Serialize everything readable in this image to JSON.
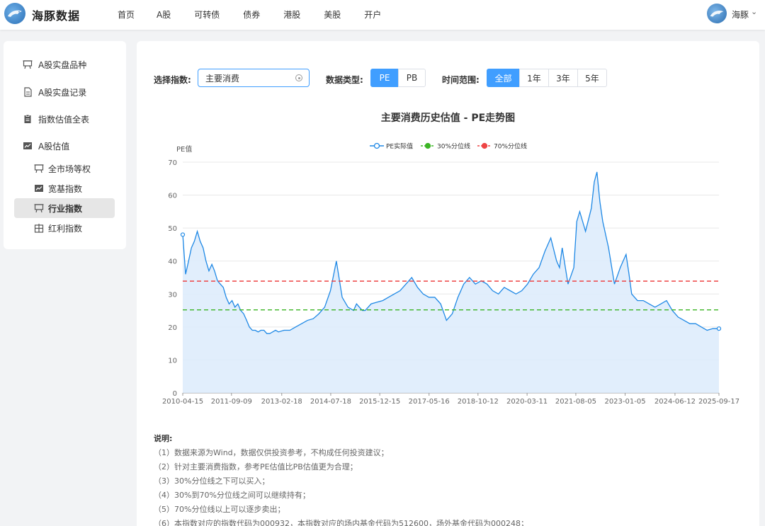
{
  "header": {
    "logo_text": "海豚数据",
    "nav": [
      "首页",
      "A股",
      "可转债",
      "债券",
      "港股",
      "美股",
      "开户"
    ],
    "user_name": "海豚"
  },
  "sidebar": {
    "items": [
      {
        "label": "A股实盘品种",
        "icon": "presentation-icon"
      },
      {
        "label": "A股实盘记录",
        "icon": "document-icon"
      },
      {
        "label": "指数估值全表",
        "icon": "clipboard-icon"
      },
      {
        "label": "A股估值",
        "icon": "chart-icon"
      }
    ],
    "sub_items": [
      {
        "label": "全市场等权",
        "icon": "presentation-icon"
      },
      {
        "label": "宽基指数",
        "icon": "chart-icon"
      },
      {
        "label": "行业指数",
        "icon": "presentation-icon",
        "active": true
      },
      {
        "label": "红利指数",
        "icon": "grid-icon"
      }
    ]
  },
  "controls": {
    "index_label": "选择指数:",
    "index_value": "主要消费",
    "type_label": "数据类型:",
    "type_options": [
      "PE",
      "PB"
    ],
    "type_selected": "PE",
    "range_label": "时间范围:",
    "range_options": [
      "全部",
      "1年",
      "3年",
      "5年"
    ],
    "range_selected": "全部"
  },
  "chart_data": {
    "type": "line",
    "title": "主要消费历史估值 - PE走势图",
    "ylabel": "PE值",
    "ylim": [
      0,
      70
    ],
    "yticks": [
      0,
      10,
      20,
      30,
      40,
      50,
      60,
      70
    ],
    "xtick_labels": [
      "2010-04-15",
      "2011-09-09",
      "2013-02-18",
      "2014-07-18",
      "2015-12-15",
      "2017-05-16",
      "2018-10-12",
      "2020-03-11",
      "2021-08-05",
      "2023-01-05",
      "2024-06-12",
      "2025-09-17"
    ],
    "legend": [
      "PE实际值",
      "30%分位线",
      "70%分位线"
    ],
    "legend_position": "top-center",
    "colors": {
      "pe": "#1e88e5",
      "p30": "#3cb525",
      "p70": "#ee4444",
      "area": "#dcebfb"
    },
    "percentile_30": 25.2,
    "percentile_70": 33.9,
    "series": [
      {
        "name": "PE实际值",
        "x": [
          "2010-04-15",
          "2010-05-15",
          "2010-06-15",
          "2010-07-15",
          "2010-08-15",
          "2010-09-15",
          "2010-10-15",
          "2010-11-15",
          "2010-12-15",
          "2011-01-15",
          "2011-02-15",
          "2011-03-15",
          "2011-04-15",
          "2011-05-15",
          "2011-06-15",
          "2011-07-15",
          "2011-08-15",
          "2011-09-15",
          "2011-10-15",
          "2011-11-15",
          "2011-12-15",
          "2012-01-15",
          "2012-02-15",
          "2012-03-15",
          "2012-04-15",
          "2012-05-15",
          "2012-06-15",
          "2012-07-15",
          "2012-08-15",
          "2012-09-15",
          "2012-10-15",
          "2012-11-15",
          "2012-12-15",
          "2013-01-15",
          "2013-03-15",
          "2013-05-15",
          "2013-07-15",
          "2013-09-15",
          "2013-11-15",
          "2014-01-15",
          "2014-03-15",
          "2014-05-15",
          "2014-07-15",
          "2014-09-15",
          "2014-11-15",
          "2015-01-15",
          "2015-03-15",
          "2015-04-15",
          "2015-05-15",
          "2015-06-15",
          "2015-07-15",
          "2015-08-15",
          "2015-09-15",
          "2015-11-15",
          "2016-01-15",
          "2016-03-15",
          "2016-05-15",
          "2016-07-15",
          "2016-09-15",
          "2016-11-15",
          "2017-01-15",
          "2017-03-15",
          "2017-05-15",
          "2017-07-15",
          "2017-09-15",
          "2017-11-15",
          "2018-01-15",
          "2018-03-15",
          "2018-05-15",
          "2018-07-15",
          "2018-09-15",
          "2018-11-15",
          "2019-01-15",
          "2019-03-15",
          "2019-05-15",
          "2019-07-15",
          "2019-09-15",
          "2019-11-15",
          "2020-01-15",
          "2020-03-15",
          "2020-05-15",
          "2020-07-15",
          "2020-09-15",
          "2020-11-15",
          "2021-01-15",
          "2021-02-15",
          "2021-03-15",
          "2021-05-15",
          "2021-07-15",
          "2021-08-15",
          "2021-09-15",
          "2021-11-15",
          "2022-01-15",
          "2022-02-15",
          "2022-03-15",
          "2022-04-15",
          "2022-05-15",
          "2022-07-15",
          "2022-09-15",
          "2022-11-15",
          "2022-12-15",
          "2023-01-15",
          "2023-02-15",
          "2023-03-15",
          "2023-05-15",
          "2023-07-15",
          "2023-09-15",
          "2023-11-15",
          "2024-01-15",
          "2024-03-15",
          "2024-05-15",
          "2024-07-15",
          "2024-09-15",
          "2024-11-15",
          "2025-01-15",
          "2025-03-15",
          "2025-05-15",
          "2025-07-15",
          "2025-09-17"
        ],
        "values": [
          48,
          36,
          40,
          44,
          46,
          49,
          46,
          44,
          40,
          37,
          39,
          37,
          34,
          33,
          32,
          29,
          27,
          28,
          26,
          27,
          25,
          24,
          22,
          20,
          19,
          19,
          18.5,
          19,
          19,
          18,
          18,
          18.5,
          19,
          18.5,
          19,
          19,
          20,
          21,
          22,
          22.5,
          24,
          26,
          31,
          40,
          29,
          26,
          25,
          27,
          26,
          25,
          25,
          26,
          27,
          27.5,
          28,
          29,
          30,
          31,
          33,
          35,
          32,
          30,
          29,
          29,
          27,
          22,
          24,
          29,
          33,
          35,
          33,
          34,
          33,
          31,
          30,
          32,
          31,
          30,
          31,
          33,
          36,
          38,
          43,
          47,
          40,
          38,
          44,
          33,
          38,
          52,
          55,
          49,
          56,
          64,
          67,
          58,
          52,
          44,
          33,
          38,
          40,
          42,
          36,
          30,
          28,
          28,
          27,
          26,
          27,
          28,
          25,
          23,
          22,
          21,
          21,
          20,
          19,
          19.5,
          19.5
        ]
      }
    ]
  },
  "notes": {
    "title": "说明:",
    "lines": [
      "（1）数据来源为Wind，数据仅供投资参考，不构成任何投资建议；",
      "（2）针对主要消费指数，参考PE估值比PB估值更为合理；",
      "（3）30%分位线之下可以买入；",
      "（4）30%到70%分位线之间可以继续持有；",
      "（5）70%分位线以上可以逐步卖出；",
      "（6）本指数对应的指数代码为000932，本指数对应的场内基金代码为512600，场外基金代码为000248；"
    ]
  }
}
